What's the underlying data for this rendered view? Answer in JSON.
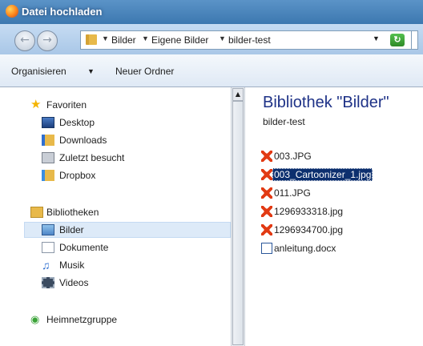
{
  "window": {
    "title": "Datei hochladen"
  },
  "address": {
    "crumbs": [
      "Bilder",
      "Eigene Bilder",
      "bilder-test"
    ]
  },
  "toolbar": {
    "organize_label": "Organisieren",
    "new_folder_label": "Neuer Ordner"
  },
  "nav": {
    "favorites_label": "Favoriten",
    "favorites": [
      "Desktop",
      "Downloads",
      "Zuletzt besucht",
      "Dropbox"
    ],
    "libraries_label": "Bibliotheken",
    "libraries": [
      "Bilder",
      "Dokumente",
      "Musik",
      "Videos"
    ],
    "selected_library": "Bilder",
    "homegroup_label": "Heimnetzgruppe"
  },
  "library": {
    "title": "Bibliothek \"Bilder\"",
    "subtitle": "bilder-test",
    "files": [
      {
        "name": "003.JPG",
        "icon": "jpg-image-icon"
      },
      {
        "name": "003_Cartoonizer_1.jpg",
        "icon": "jpg-image-icon",
        "selected": true
      },
      {
        "name": "011.JPG",
        "icon": "jpg-image-icon"
      },
      {
        "name": "1296933318.jpg",
        "icon": "jpg-image-icon"
      },
      {
        "name": "1296934700.jpg",
        "icon": "jpg-image-icon"
      },
      {
        "name": "anleitung.docx",
        "icon": "word-document-icon"
      }
    ]
  },
  "colors": {
    "selection": "#0c2f6e",
    "title_blue": "#1e3287"
  }
}
